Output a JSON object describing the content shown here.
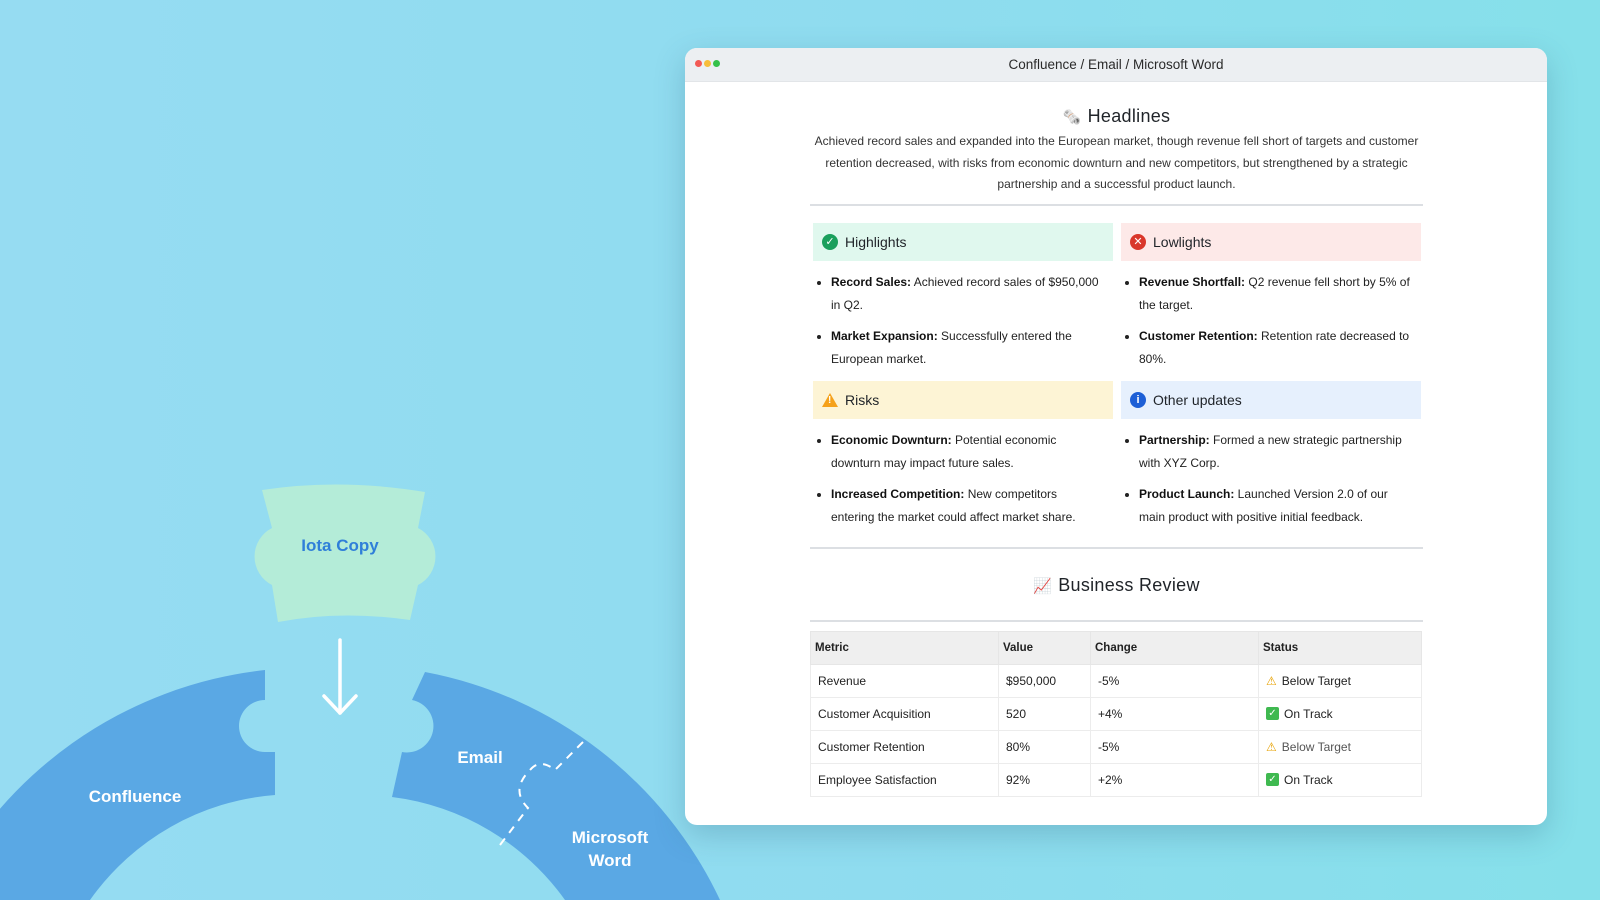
{
  "diagram": {
    "center_label": "Iota Copy",
    "confluence_label": "Confluence",
    "email_label": "Email",
    "word_label": "Microsoft Word"
  },
  "window": {
    "title": "Confluence / Email / Microsoft Word"
  },
  "headlines": {
    "emoji": "🗞️",
    "title": "Headlines",
    "text": "Achieved record sales and expanded into the European market, though revenue fell short of targets and customer retention decreased, with risks from economic downturn and new competitors, but strengthened by a strategic partnership and a successful product launch."
  },
  "cards": {
    "highlights": {
      "title": "Highlights",
      "items": [
        {
          "label": "Record Sales:",
          "text": " Achieved record sales of $950,000 in Q2."
        },
        {
          "label": "Market Expansion:",
          "text": " Successfully entered the European market."
        }
      ]
    },
    "lowlights": {
      "title": "Lowlights",
      "items": [
        {
          "label": "Revenue Shortfall:",
          "text": " Q2 revenue fell short by 5% of the target."
        },
        {
          "label": "Customer Retention:",
          "text": " Retention rate decreased to 80%."
        }
      ]
    },
    "risks": {
      "title": "Risks",
      "items": [
        {
          "label": "Economic Downturn:",
          "text": " Potential economic downturn may impact future sales."
        },
        {
          "label": "Increased Competition:",
          "text": " New competitors entering the market could affect market share."
        }
      ]
    },
    "other": {
      "title": "Other updates",
      "items": [
        {
          "label": "Partnership:",
          "text": " Formed a new strategic partnership with XYZ Corp."
        },
        {
          "label": "Product Launch:",
          "text": " Launched Version 2.0 of our main product with positive initial feedback."
        }
      ]
    }
  },
  "review": {
    "emoji": "📈",
    "title": "Business Review",
    "headers": [
      "Metric",
      "Value",
      "Change",
      "Status"
    ],
    "rows": [
      {
        "metric": "Revenue",
        "value": "$950,000",
        "change": "-5%",
        "status": "Below Target",
        "status_icon": "warning-icon"
      },
      {
        "metric": "Customer Acquisition",
        "value": "520",
        "change": "+4%",
        "status": "On Track",
        "status_icon": "check-icon"
      },
      {
        "metric": "Customer Retention",
        "value": "80%",
        "change": "-5%",
        "status": "Below Target",
        "status_icon": "warning-icon"
      },
      {
        "metric": "Employee Satisfaction",
        "value": "92%",
        "change": "+2%",
        "status": "On Track",
        "status_icon": "check-icon"
      }
    ]
  },
  "colors": {
    "background": "#96dcf2",
    "ring": "#5aa8e4",
    "iota_shape": "#b4ecd8",
    "iota_text": "#2f7fd9",
    "highlight_green": "#1a9f5c",
    "lowlight_red": "#d9372b",
    "risk_orange": "#f5a11a",
    "info_blue": "#1d5fd6"
  }
}
